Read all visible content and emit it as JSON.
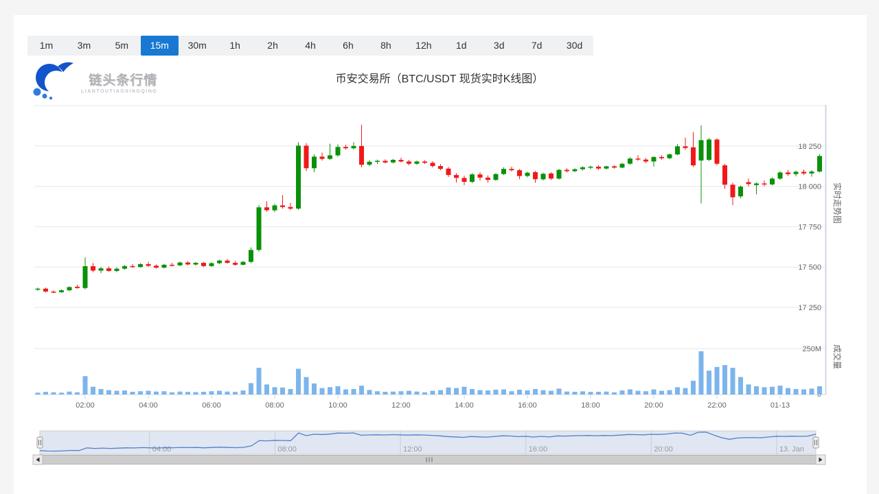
{
  "toolbar": {
    "timeframes": [
      "1m",
      "3m",
      "5m",
      "15m",
      "30m",
      "1h",
      "2h",
      "4h",
      "6h",
      "8h",
      "12h",
      "1d",
      "3d",
      "7d",
      "30d"
    ],
    "selected": "15m",
    "selected_color": "#1878d2"
  },
  "logo": {
    "text": "链头条行情",
    "subtext": "LIANTOUTIAOXINGQING"
  },
  "header": {
    "title": "币安交易所（BTC/USDT 现货实时K线图）"
  },
  "chart_data": {
    "type": "candlestick+volume",
    "title": "币安交易所（BTC/USDT 现货实时K线图）",
    "start_time": "00:30",
    "interval_minutes": 15,
    "price_axis": {
      "title": "实时走势图",
      "ticks": [
        18500,
        18250,
        18000,
        17750,
        17500,
        17250
      ],
      "tick_labels": [
        "",
        "18 250",
        "18 000",
        "17 750",
        "17 500",
        "17 250"
      ]
    },
    "volume_axis": {
      "title": "成交量",
      "tick_top_label": "250M",
      "tick_bottom_label": "0",
      "max": 250
    },
    "colors": {
      "up": "#0a910a",
      "down": "#f01919",
      "volume": "#7cb5ec",
      "navigator_line": "#4f7fc9"
    },
    "x_labels": [
      {
        "index": 6,
        "label": "02:00"
      },
      {
        "index": 14,
        "label": "04:00"
      },
      {
        "index": 22,
        "label": "06:00"
      },
      {
        "index": 30,
        "label": "08:00"
      },
      {
        "index": 38,
        "label": "10:00"
      },
      {
        "index": 46,
        "label": "12:00"
      },
      {
        "index": 54,
        "label": "14:00"
      },
      {
        "index": 62,
        "label": "16:00"
      },
      {
        "index": 70,
        "label": "18:00"
      },
      {
        "index": 78,
        "label": "20:00"
      },
      {
        "index": 86,
        "label": "22:00"
      },
      {
        "index": 94,
        "label": "01-13"
      }
    ],
    "navigator": {
      "labels": [
        {
          "index": 14,
          "label": "04:00"
        },
        {
          "index": 30,
          "label": "08:00"
        },
        {
          "index": 46,
          "label": "12:00"
        },
        {
          "index": 62,
          "label": "16:00"
        },
        {
          "index": 78,
          "label": "20:00"
        },
        {
          "index": 94,
          "label": "13. Jan"
        }
      ]
    },
    "candles": [
      [
        17362,
        17372,
        17352,
        17366,
        10
      ],
      [
        17366,
        17372,
        17342,
        17348,
        14
      ],
      [
        17348,
        17356,
        17338,
        17344,
        12
      ],
      [
        17344,
        17362,
        17340,
        17356,
        10
      ],
      [
        17356,
        17380,
        17350,
        17376,
        16
      ],
      [
        17378,
        17390,
        17366,
        17370,
        12
      ],
      [
        17370,
        17560,
        17362,
        17505,
        100
      ],
      [
        17505,
        17525,
        17468,
        17478,
        42
      ],
      [
        17478,
        17502,
        17462,
        17492,
        30
      ],
      [
        17492,
        17504,
        17470,
        17476,
        24
      ],
      [
        17476,
        17498,
        17468,
        17490,
        20
      ],
      [
        17490,
        17512,
        17484,
        17506,
        22
      ],
      [
        17506,
        17518,
        17494,
        17500,
        15
      ],
      [
        17500,
        17524,
        17496,
        17518,
        18
      ],
      [
        17518,
        17532,
        17500,
        17508,
        20
      ],
      [
        17508,
        17516,
        17490,
        17496,
        16
      ],
      [
        17496,
        17520,
        17492,
        17514,
        18
      ],
      [
        17514,
        17526,
        17504,
        17510,
        12
      ],
      [
        17510,
        17534,
        17506,
        17528,
        16
      ],
      [
        17528,
        17536,
        17510,
        17516,
        14
      ],
      [
        17516,
        17532,
        17508,
        17526,
        13
      ],
      [
        17526,
        17532,
        17500,
        17506,
        15
      ],
      [
        17506,
        17530,
        17502,
        17524,
        18
      ],
      [
        17524,
        17546,
        17518,
        17540,
        20
      ],
      [
        17540,
        17550,
        17520,
        17526,
        16
      ],
      [
        17526,
        17538,
        17508,
        17514,
        14
      ],
      [
        17514,
        17538,
        17510,
        17532,
        22
      ],
      [
        17532,
        17622,
        17524,
        17606,
        62
      ],
      [
        17606,
        17884,
        17596,
        17870,
        145
      ],
      [
        17870,
        17908,
        17842,
        17852,
        55
      ],
      [
        17852,
        17892,
        17840,
        17882,
        40
      ],
      [
        17882,
        17946,
        17862,
        17872,
        38
      ],
      [
        17872,
        17898,
        17852,
        17862,
        30
      ],
      [
        17862,
        18274,
        17854,
        18252,
        140
      ],
      [
        18252,
        18268,
        18094,
        18112,
        95
      ],
      [
        18112,
        18198,
        18088,
        18184,
        60
      ],
      [
        18184,
        18210,
        18160,
        18170,
        35
      ],
      [
        18170,
        18264,
        18164,
        18192,
        40
      ],
      [
        18192,
        18260,
        18184,
        18244,
        45
      ],
      [
        18244,
        18258,
        18228,
        18236,
        28
      ],
      [
        18236,
        18274,
        18230,
        18250,
        30
      ],
      [
        18250,
        18382,
        18118,
        18134,
        48
      ],
      [
        18134,
        18162,
        18124,
        18152,
        25
      ],
      [
        18152,
        18166,
        18138,
        18158,
        18
      ],
      [
        18158,
        18168,
        18142,
        18148,
        15
      ],
      [
        18148,
        18170,
        18142,
        18164,
        16
      ],
      [
        18164,
        18178,
        18148,
        18154,
        18
      ],
      [
        18154,
        18164,
        18130,
        18140,
        20
      ],
      [
        18140,
        18160,
        18134,
        18154,
        16
      ],
      [
        18154,
        18162,
        18138,
        18146,
        12
      ],
      [
        18146,
        18156,
        18116,
        18126,
        20
      ],
      [
        18126,
        18138,
        18100,
        18108,
        24
      ],
      [
        18110,
        18120,
        18058,
        18070,
        38
      ],
      [
        18070,
        18082,
        18024,
        18052,
        35
      ],
      [
        18052,
        18066,
        18008,
        18028,
        42
      ],
      [
        18028,
        18082,
        18020,
        18074,
        30
      ],
      [
        18074,
        18088,
        18036,
        18054,
        24
      ],
      [
        18054,
        18068,
        18024,
        18040,
        22
      ],
      [
        18040,
        18082,
        18034,
        18076,
        26
      ],
      [
        18076,
        18118,
        18070,
        18108,
        28
      ],
      [
        18108,
        18122,
        18092,
        18100,
        18
      ],
      [
        18100,
        18108,
        18044,
        18064,
        26
      ],
      [
        18064,
        18090,
        18056,
        18084,
        22
      ],
      [
        18088,
        18096,
        18022,
        18044,
        30
      ],
      [
        18044,
        18084,
        18036,
        18078,
        24
      ],
      [
        18080,
        18088,
        18040,
        18048,
        20
      ],
      [
        18048,
        18108,
        18042,
        18102,
        32
      ],
      [
        18102,
        18112,
        18086,
        18094,
        16
      ],
      [
        18094,
        18112,
        18088,
        18106,
        15
      ],
      [
        18106,
        18124,
        18098,
        18118,
        17
      ],
      [
        18118,
        18128,
        18106,
        18122,
        14
      ],
      [
        18122,
        18130,
        18102,
        18110,
        15
      ],
      [
        18110,
        18128,
        18104,
        18124,
        16
      ],
      [
        18124,
        18132,
        18110,
        18116,
        12
      ],
      [
        18116,
        18146,
        18112,
        18140,
        22
      ],
      [
        18140,
        18180,
        18134,
        18172,
        28
      ],
      [
        18172,
        18192,
        18158,
        18166,
        20
      ],
      [
        18166,
        18176,
        18144,
        18154,
        18
      ],
      [
        18154,
        18186,
        18122,
        18182,
        28
      ],
      [
        18182,
        18192,
        18166,
        18174,
        20
      ],
      [
        18174,
        18204,
        18168,
        18198,
        24
      ],
      [
        18198,
        18262,
        18192,
        18248,
        40
      ],
      [
        18248,
        18302,
        18226,
        18238,
        35
      ],
      [
        18242,
        18336,
        18120,
        18130,
        75
      ],
      [
        18160,
        18378,
        17894,
        18286,
        235
      ],
      [
        18164,
        18300,
        18156,
        18290,
        130
      ],
      [
        18290,
        18298,
        18130,
        18140,
        150
      ],
      [
        18130,
        18140,
        17984,
        18010,
        160
      ],
      [
        18010,
        18022,
        17884,
        17932,
        145
      ],
      [
        17938,
        18006,
        17926,
        17998,
        95
      ],
      [
        18026,
        18048,
        18000,
        18014,
        55
      ],
      [
        18008,
        18026,
        17950,
        18018,
        45
      ],
      [
        18018,
        18036,
        18000,
        18012,
        40
      ],
      [
        18012,
        18056,
        18006,
        18048,
        42
      ],
      [
        18048,
        18094,
        18040,
        18086,
        48
      ],
      [
        18086,
        18102,
        18064,
        18076,
        35
      ],
      [
        18076,
        18098,
        18062,
        18090,
        30
      ],
      [
        18090,
        18104,
        18070,
        18080,
        28
      ],
      [
        18080,
        18100,
        18060,
        18092,
        32
      ],
      [
        18092,
        18200,
        18086,
        18188,
        45
      ]
    ]
  }
}
